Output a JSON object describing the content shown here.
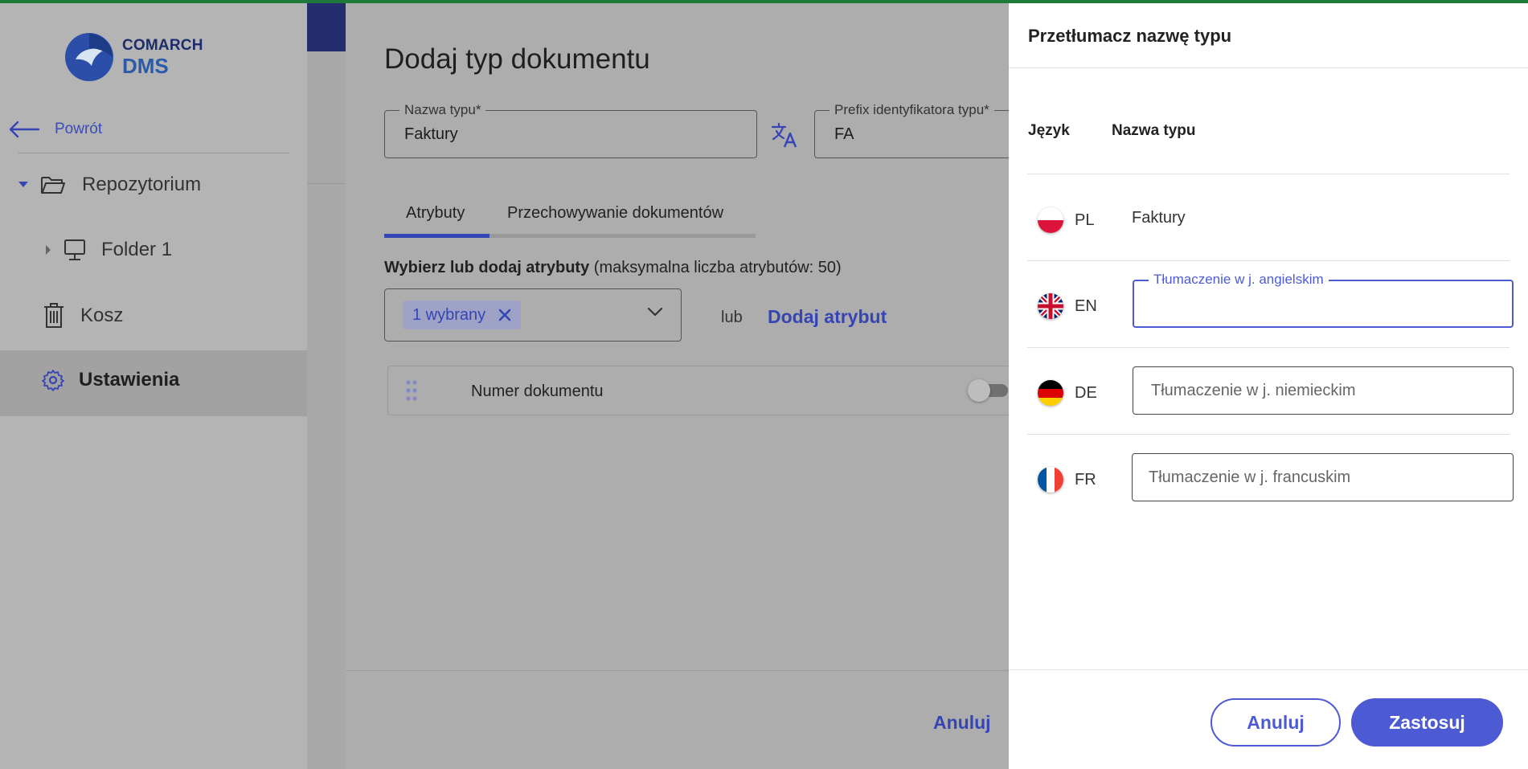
{
  "app": {
    "logo_line1": "COMARCH",
    "logo_line2": "DMS",
    "brand_color": "#3545b5",
    "accent_bar_color": "#1f7a3a"
  },
  "sidebar": {
    "back_label": "Powrót",
    "items": [
      {
        "label": "Repozytorium",
        "icon": "folder-open-icon",
        "expanded": true
      },
      {
        "label": "Folder 1",
        "icon": "computer-icon",
        "expanded": false
      },
      {
        "label": "Kosz",
        "icon": "trash-icon"
      },
      {
        "label": "Ustawienia",
        "icon": "gear-icon",
        "active": true
      }
    ]
  },
  "dialog": {
    "title": "Dodaj typ dokumentu",
    "type_name_label": "Nazwa typu*",
    "type_name_value": "Faktury",
    "prefix_label": "Prefix identyfikatora typu*",
    "prefix_value": "FA",
    "tabs": [
      {
        "label": "Atrybuty",
        "active": true
      },
      {
        "label": "Przechowywanie dokumentów",
        "active": false
      }
    ],
    "attributes_heading_bold": "Wybierz lub dodaj atrybuty",
    "attributes_heading_rest": "(maksymalna liczba atrybutów: 50)",
    "selected_chip": "1 wybrany",
    "or_label": "lub",
    "add_attribute": "Dodaj atrybut",
    "attribute_rows": [
      {
        "label": "Numer dokumentu",
        "enabled": false
      }
    ],
    "cancel_label": "Anuluj"
  },
  "panel": {
    "title": "Przetłumacz nazwę typu",
    "col_language": "Język",
    "col_name": "Nazwa typu",
    "rows": [
      {
        "code": "PL",
        "flag": "pl-flag-icon",
        "value": "Faktury"
      },
      {
        "code": "EN",
        "flag": "gb-flag-icon",
        "label": "Tłumaczenie w j. angielskim",
        "value": ""
      },
      {
        "code": "DE",
        "flag": "de-flag-icon",
        "placeholder": "Tłumaczenie w j. niemieckim"
      },
      {
        "code": "FR",
        "flag": "fr-flag-icon",
        "placeholder": "Tłumaczenie w j. francuskim"
      }
    ],
    "cancel_label": "Anuluj",
    "apply_label": "Zastosuj"
  }
}
